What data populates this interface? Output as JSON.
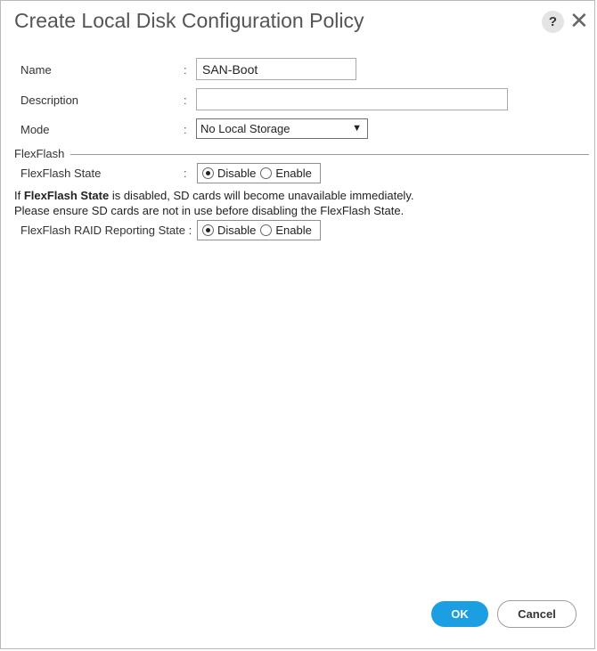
{
  "dialog": {
    "title": "Create Local Disk Configuration Policy",
    "help_label": "?",
    "close_label": "✕"
  },
  "form": {
    "name": {
      "label": "Name",
      "colon": ":",
      "value": "SAN-Boot"
    },
    "description": {
      "label": "Description",
      "colon": ":",
      "value": ""
    },
    "mode": {
      "label": "Mode",
      "colon": ":",
      "selected": "No Local Storage",
      "caret": "▼"
    }
  },
  "flexflash": {
    "section_title": "FlexFlash",
    "state": {
      "label": "FlexFlash State",
      "colon": ":",
      "options": [
        "Disable",
        "Enable"
      ],
      "selected": "Disable"
    },
    "warning": {
      "prefix": "If ",
      "bold": "FlexFlash State",
      "suffix": " is disabled, SD cards will become unavailable immediately.",
      "line2": "Please ensure SD cards are not in use before disabling the FlexFlash State."
    },
    "raid_state": {
      "label": "FlexFlash RAID Reporting State :",
      "options": [
        "Disable",
        "Enable"
      ],
      "selected": "Disable"
    }
  },
  "buttons": {
    "ok": "OK",
    "cancel": "Cancel"
  },
  "colors": {
    "accent": "#1b9fe2"
  }
}
